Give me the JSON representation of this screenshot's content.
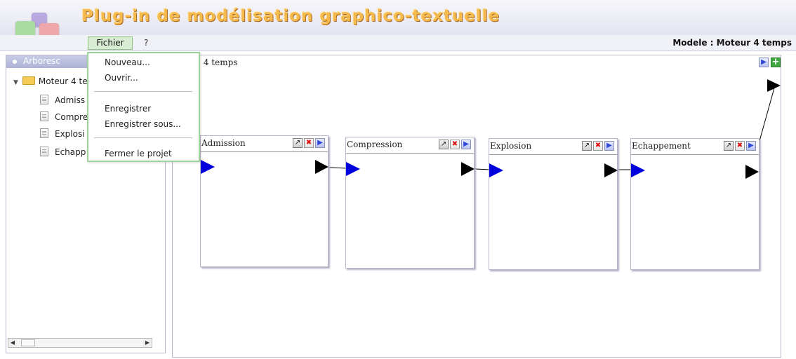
{
  "app": {
    "title": "Plug-in de modélisation graphico-textuelle"
  },
  "menubar": {
    "fichier": "Fichier",
    "help": "?"
  },
  "model_label": "Modele : Moteur 4 temps",
  "file_menu": {
    "items": [
      "Nouveau...",
      "Ouvrir...",
      "Enregistrer",
      "Enregistrer sous...",
      "Fermer le projet"
    ]
  },
  "left_panel": {
    "title": "Arboresc",
    "root": "Moteur 4 te",
    "items": [
      "Admiss",
      "Compre",
      "Explosi",
      "Echapp"
    ]
  },
  "canvas": {
    "title": ": 4 temps"
  },
  "nodes": [
    "Admission",
    "Compression",
    "Explosion",
    "Echappement"
  ],
  "colors": {
    "input_arrow": "#0000dd",
    "output_arrow": "#000000",
    "title_accent": "#f5ba4e"
  },
  "icons": {
    "open": "arrow-out-icon",
    "delete": "red-x-icon",
    "run": "play-icon",
    "add": "green-plus-icon"
  }
}
